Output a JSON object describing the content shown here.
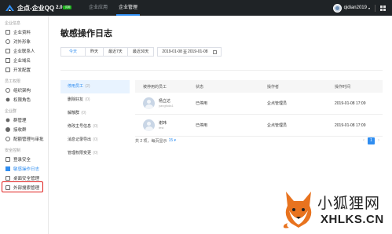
{
  "topbar": {
    "logo_text": "企点-企业QQ",
    "logo_version": "2.0",
    "logo_badge": "试用",
    "nav": [
      {
        "label": "企业应用",
        "active": false
      },
      {
        "label": "企业管理",
        "active": true
      }
    ],
    "user_name": "qidian2019",
    "user_caret": "▾"
  },
  "sidebar": {
    "groups": [
      {
        "title": "企业信息",
        "items": [
          {
            "label": "企业资料",
            "icon": "building-icon"
          },
          {
            "label": "对外形象",
            "icon": "image-icon"
          },
          {
            "label": "企业联系人",
            "icon": "contact-icon"
          },
          {
            "label": "企业域名",
            "icon": "domain-icon"
          },
          {
            "label": "开发配置",
            "icon": "code-icon"
          }
        ]
      },
      {
        "title": "员工权限",
        "items": [
          {
            "label": "组织架构",
            "icon": "org-icon"
          },
          {
            "label": "权限角色",
            "icon": "role-icon"
          }
        ]
      },
      {
        "title": "企业群",
        "items": [
          {
            "label": "群管理",
            "icon": "group-icon"
          },
          {
            "label": "接收群",
            "icon": "receive-icon"
          },
          {
            "label": "配额管理与审批",
            "icon": "quota-icon"
          }
        ]
      },
      {
        "title": "安全控制",
        "items": [
          {
            "label": "登录安全",
            "icon": "lock-icon"
          },
          {
            "label": "敏感操作日志",
            "icon": "log-icon",
            "active": true
          },
          {
            "label": "桌面安全管理",
            "icon": "desktop-icon"
          },
          {
            "label": "外部搜索管理",
            "icon": "search-icon"
          }
        ]
      }
    ]
  },
  "main": {
    "title": "敏感操作日志",
    "filters": {
      "buttons": [
        {
          "label": "今天",
          "active": true
        },
        {
          "label": "昨天",
          "active": false
        },
        {
          "label": "最近7天",
          "active": false
        },
        {
          "label": "最近30天",
          "active": false
        }
      ],
      "date_start": "2019-01-08",
      "date_sep": "至",
      "date_end": "2019-01-08"
    },
    "categories": [
      {
        "label": "停用员工",
        "count": "(2)",
        "active": true
      },
      {
        "label": "删除好友",
        "count": "(0)"
      },
      {
        "label": "解散群",
        "count": "(0)"
      },
      {
        "label": "修改主号信息",
        "count": "(0)"
      },
      {
        "label": "消息记录导出",
        "count": "(0)"
      },
      {
        "label": "管理权限变更",
        "count": "(0)"
      }
    ],
    "table": {
      "headers": [
        "被停用的员工",
        "状态",
        "操作者",
        "操作时间"
      ],
      "rows": [
        {
          "name": "杨立达",
          "account": "yangfuda1",
          "status": "已停用",
          "operator": "企点管理员",
          "time": "2019-01-08 17:09"
        },
        {
          "name": "谢玮",
          "account": "test",
          "status": "已停用",
          "operator": "企点管理员",
          "time": "2019-01-08 17:09"
        }
      ]
    },
    "pagination": {
      "summary": "共 2 项，每页显示",
      "page_size": "15 ▾",
      "prev": "‹",
      "current": "1",
      "next": "›"
    }
  },
  "watermark": {
    "title": "小狐狸网",
    "url": "XHLKS.CN"
  },
  "colors": {
    "topbar_bg": "#1f2326",
    "accent": "#2f8df0",
    "highlight_border": "#e0201e"
  }
}
